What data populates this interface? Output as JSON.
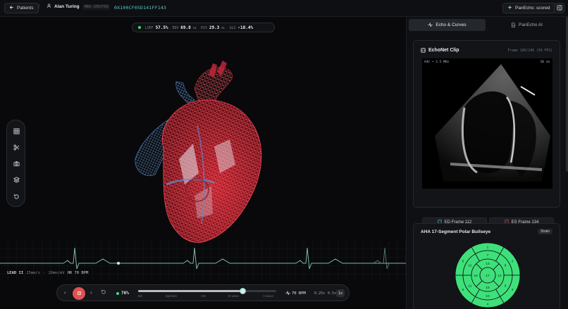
{
  "topbar": {
    "back_label": "Patients",
    "patient_name": "Alan Turing",
    "patient_mrn": "MRN-100CF05",
    "study_id": "0X100CF05D141FF143",
    "scored_badge": "PanEcho: scored"
  },
  "metrics": [
    {
      "key": "LVEF",
      "value": "57.5%",
      "unit": ""
    },
    {
      "key": "EDV",
      "value": "69.8",
      "unit": "mL"
    },
    {
      "key": "ESV",
      "value": "29.3",
      "unit": "mL"
    },
    {
      "key": "GLS",
      "value": "-18.4%",
      "unit": ""
    }
  ],
  "tools": [
    "grid-icon",
    "scissors-icon",
    "camera-icon",
    "layers-icon",
    "reset-icon"
  ],
  "ecg": {
    "lead": "LEAD II",
    "speed": "25mm/s",
    "gain": "10mm/mV",
    "hr": "HR 70 BPM"
  },
  "transport": {
    "progress": "76%",
    "progress_value": 0.76,
    "phases": [
      "ED",
      "Ejection",
      "ES",
      "E-wave",
      "A-wave"
    ],
    "bpm": "70 BPM",
    "speeds": [
      "0.25x",
      "0.5x",
      "1x"
    ],
    "active_speed": "1x"
  },
  "tabs": [
    {
      "label": "Echo & Curves",
      "active": true
    },
    {
      "label": "PanEcho AI",
      "active": false
    }
  ],
  "echo": {
    "title": "EchoNet Clip",
    "frame_info": "Frame 109/246 (50 FPS)",
    "view_label": "A4C • 2.5 MHz",
    "depth_label": "10 cm",
    "ed_frame": "ED Frame 112",
    "es_frame": "ES Frame 134"
  },
  "bullseye": {
    "title": "AHA 17-Segment Polar Bullseye",
    "badge": "Strain",
    "fill_color": "#3ee07a",
    "segments": [
      "1",
      "2",
      "3",
      "4",
      "5",
      "6",
      "7",
      "8",
      "9",
      "10",
      "11",
      "12",
      "13",
      "14",
      "15",
      "16",
      "17"
    ]
  },
  "colors": {
    "accent": "#5ec8c2",
    "record": "#e05252",
    "heart_red": "#e0303c",
    "heart_blue": "#4f86c9",
    "ecg_trace": "#7fb7ad"
  }
}
